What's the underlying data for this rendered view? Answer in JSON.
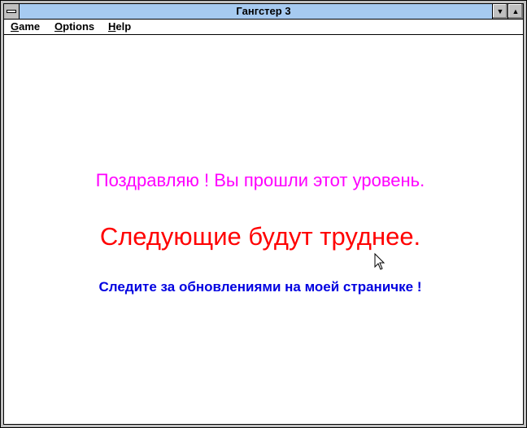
{
  "window": {
    "title": "Гангстер 3"
  },
  "menu": [
    {
      "label": "Game",
      "mnemonic": "G",
      "rest": "ame"
    },
    {
      "label": "Options",
      "mnemonic": "O",
      "rest": "ptions"
    },
    {
      "label": "Help",
      "mnemonic": "H",
      "rest": "elp"
    }
  ],
  "content": {
    "line1": "Поздравляю ! Вы прошли этот уровень.",
    "line2": "Следующие будут труднее.",
    "line3": "Следите за обновлениями на моей страничке !"
  },
  "colors": {
    "line1": "#ff00ff",
    "line2": "#ff0000",
    "line3": "#0000e0",
    "titlebar": "#a6caf0"
  }
}
